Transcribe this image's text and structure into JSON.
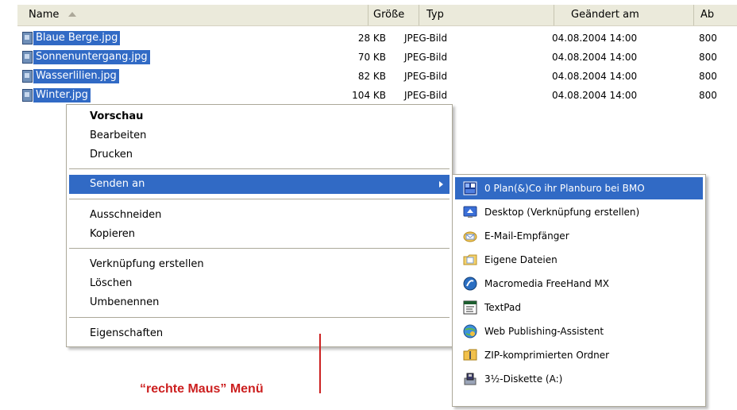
{
  "header": {
    "name": "Name",
    "size": "Größe",
    "type": "Typ",
    "modified": "Geändert am",
    "attr": "Ab"
  },
  "files": [
    {
      "name": "Blaue Berge.jpg",
      "size": "28 KB",
      "type": "JPEG-Bild",
      "date": "04.08.2004 14:00",
      "attr": "800"
    },
    {
      "name": "Sonnenuntergang.jpg",
      "size": "70 KB",
      "type": "JPEG-Bild",
      "date": "04.08.2004 14:00",
      "attr": "800"
    },
    {
      "name": "Wasserlilien.jpg",
      "size": "82 KB",
      "type": "JPEG-Bild",
      "date": "04.08.2004 14:00",
      "attr": "800"
    },
    {
      "name": "Winter.jpg",
      "size": "104 KB",
      "type": "JPEG-Bild",
      "date": "04.08.2004 14:00",
      "attr": "800"
    }
  ],
  "context_menu": {
    "preview": "Vorschau",
    "edit": "Bearbeiten",
    "print": "Drucken",
    "send_to": "Senden an",
    "cut": "Ausschneiden",
    "copy": "Kopieren",
    "create_shortcut": "Verknüpfung erstellen",
    "delete": "Löschen",
    "rename": "Umbenennen",
    "properties": "Eigenschaften"
  },
  "send_to_menu": [
    {
      "label": "0 Plan(&)Co ihr Planburo bei BMO",
      "icon": "planco-app-icon"
    },
    {
      "label": "Desktop (Verknüpfung erstellen)",
      "icon": "desktop-icon"
    },
    {
      "label": "E-Mail-Empfänger",
      "icon": "mail-icon"
    },
    {
      "label": "Eigene Dateien",
      "icon": "my-documents-icon"
    },
    {
      "label": "Macromedia FreeHand MX",
      "icon": "freehand-icon"
    },
    {
      "label": "TextPad",
      "icon": "textpad-icon"
    },
    {
      "label": "Web Publishing-Assistent",
      "icon": "web-publishing-icon"
    },
    {
      "label": "ZIP-komprimierten Ordner",
      "icon": "zip-folder-icon"
    },
    {
      "label": "3½-Diskette (A:)",
      "icon": "floppy-drive-icon"
    }
  ],
  "annotation": "“rechte Maus” Menü",
  "colors": {
    "selection": "#316ac5",
    "annotation": "#cc1f1f",
    "header_bg": "#ebeadb",
    "menu_border": "#aca899"
  }
}
